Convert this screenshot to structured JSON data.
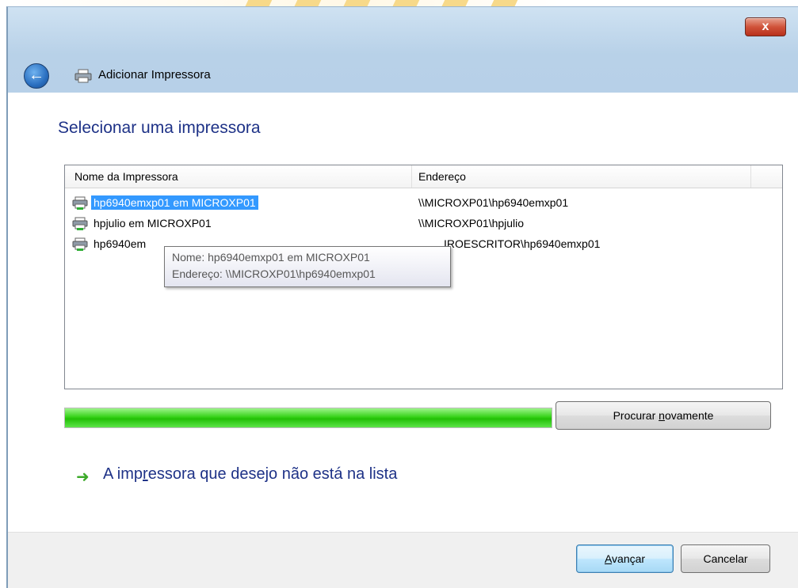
{
  "window": {
    "title": "Adicionar Impressora",
    "close_label": "x",
    "back_icon": "back-arrow-icon",
    "title_icon": "printer-icon"
  },
  "main": {
    "heading": "Selecionar uma impressora",
    "list": {
      "columns": [
        "Nome da Impressora",
        "Endereço"
      ],
      "rows": [
        {
          "name": "hp6940emxp01 em MICROXP01",
          "address": "\\\\MICROXP01\\hp6940emxp01",
          "selected": true
        },
        {
          "name": "hpjulio em MICROXP01",
          "address": "\\\\MICROXP01\\hpjulio",
          "selected": false
        },
        {
          "name": "hp6940em",
          "address": "IROESCRITOR\\hp6940emxp01",
          "selected": false
        }
      ]
    },
    "tooltip": {
      "line1": "Nome: hp6940emxp01 em MICROXP01",
      "line2": "Endereço: \\\\MICROXP01\\hp6940emxp01"
    },
    "progress": 1.0,
    "retry_button": {
      "pre": "Procurar ",
      "accel": "n",
      "post": "ovamente"
    },
    "not_listed_link": {
      "pre": "A imp",
      "accel": "r",
      "post": "essora que desejo não está na lista"
    }
  },
  "footer": {
    "next_button": {
      "accel": "A",
      "post": "vançar"
    },
    "cancel_button": "Cancelar"
  },
  "colors": {
    "heading": "#1e3287",
    "selection": "#3399ff",
    "progress": "#22c006",
    "link_arrow": "#3caa2a"
  }
}
